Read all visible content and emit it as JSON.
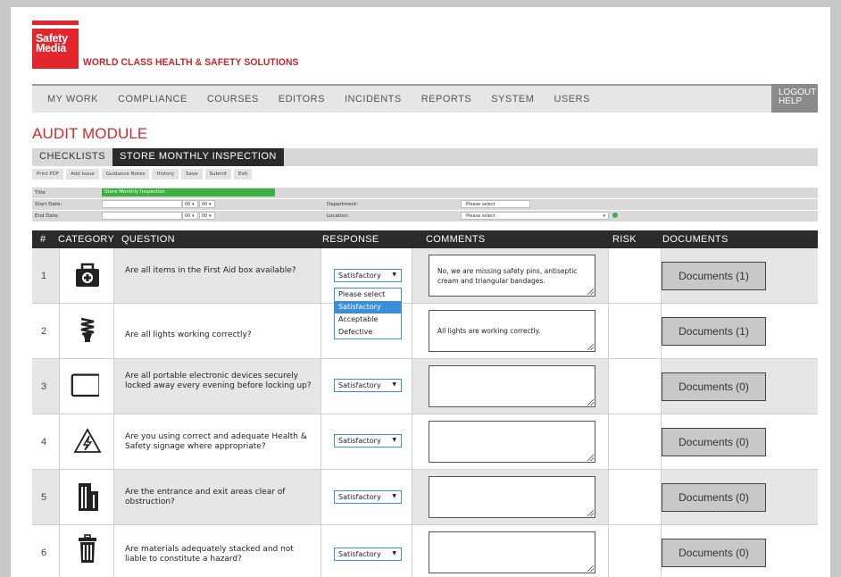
{
  "brand": {
    "logo_text": "Safety Media",
    "tagline": "WORLD CLASS HEALTH & SAFETY SOLUTIONS",
    "color": "#e3262c"
  },
  "nav": {
    "items": [
      "MY WORK",
      "COMPLIANCE",
      "COURSES",
      "EDITORS",
      "INCIDENTS",
      "REPORTS",
      "SYSTEM",
      "USERS"
    ],
    "logout": "LOGOUT",
    "help": "HELP"
  },
  "module_title": "AUDIT MODULE",
  "tabs": [
    {
      "label": "CHECKLISTS",
      "active": false
    },
    {
      "label": "STORE MONTHLY INSPECTION",
      "active": true
    }
  ],
  "toolbar": [
    "Print PDF",
    "Add Issue",
    "Guidance Notes",
    "History",
    "Save",
    "Submit",
    "Exit"
  ],
  "form": {
    "title_label": "Title",
    "title_value": "Store Monthly Inspection",
    "start_date_label": "Start Date:",
    "end_date_label": "End Date:",
    "hour": "00",
    "minute": "00",
    "department_label": "Department:",
    "department_value": "Please select",
    "location_label": "Location:",
    "location_value": "Please select"
  },
  "table": {
    "headers": [
      "#",
      "CATEGORY",
      "QUESTION",
      "RESPONSE",
      "COMMENTS",
      "RISK",
      "DOCUMENTS"
    ],
    "rows": [
      {
        "num": "1",
        "icon": "first-aid-kit-icon",
        "question": "Are all items in the First Aid box available?",
        "response": "Satisfactory",
        "comment": "No, we are missing safety pins, antiseptic cream and triangular bandages.",
        "documents": "Documents (1)"
      },
      {
        "num": "2",
        "icon": "light-bulb-icon",
        "question": "Are all lights working correctly?",
        "response": "Satisfactory",
        "comment": "All lights are working correctly.",
        "documents": "Documents (1)"
      },
      {
        "num": "3",
        "icon": "tablet-device-icon",
        "question": "Are all portable electronic devices securely locked away every evening before locking up?",
        "response": "Satisfactory",
        "comment": "",
        "documents": "Documents (0)"
      },
      {
        "num": "4",
        "icon": "electrical-warning-icon",
        "question": "Are you using correct and adequate Health & Safety signage where appropriate?",
        "response": "Satisfactory",
        "comment": "",
        "documents": "Documents (0)"
      },
      {
        "num": "5",
        "icon": "building-icon",
        "question": "Are the entrance and exit areas clear of obstruction?",
        "response": "Satisfactory",
        "comment": "",
        "documents": "Documents (0)"
      },
      {
        "num": "6",
        "icon": "trash-bin-icon",
        "question": "Are materials adequately stacked and not liable to constitute a hazard?",
        "response": "Satisfactory",
        "comment": "",
        "documents": "Documents (0)"
      }
    ]
  },
  "response_dropdown": {
    "options": [
      "Please select",
      "Satisfactory",
      "Acceptable",
      "Defective"
    ],
    "highlighted": "Satisfactory"
  }
}
